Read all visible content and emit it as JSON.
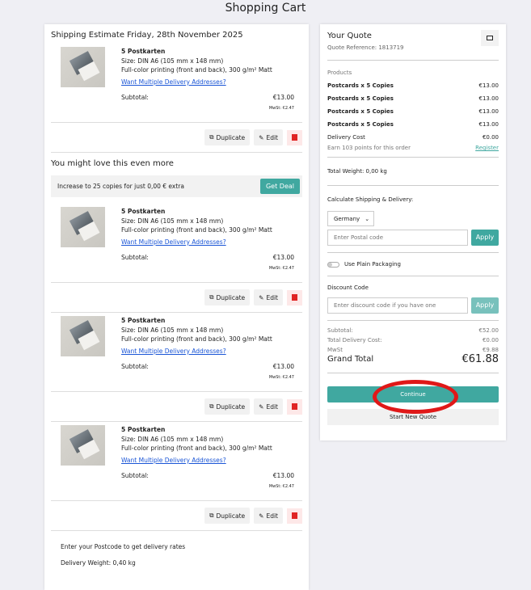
{
  "page_title": "Shopping Cart",
  "left": {
    "shipping_estimate": "Shipping Estimate Friday, 28th November 2025",
    "items": [
      {
        "name": "5 Postkarten",
        "size": "Size: DIN A6 (105 mm x 148 mm)",
        "finish": "Full-color printing (front and back), 300 g/m² Matt",
        "link": "Want Multiple Delivery Addresses?",
        "subtotal_label": "Subtotal:",
        "subtotal": "€13.00",
        "mwst": "MwSt: €2.47"
      },
      {
        "name": "5 Postkarten",
        "size": "Size: DIN A6 (105 mm x 148 mm)",
        "finish": "Full-color printing (front and back), 300 g/m² Matt",
        "link": "Want Multiple Delivery Addresses?",
        "subtotal_label": "Subtotal:",
        "subtotal": "€13.00",
        "mwst": "MwSt: €2.47"
      },
      {
        "name": "5 Postkarten",
        "size": "Size: DIN A6 (105 mm x 148 mm)",
        "finish": "Full-color printing (front and back), 300 g/m² Matt",
        "link": "Want Multiple Delivery Addresses?",
        "subtotal_label": "Subtotal:",
        "subtotal": "€13.00",
        "mwst": "MwSt: €2.47"
      },
      {
        "name": "5 Postkarten",
        "size": "Size: DIN A6 (105 mm x 148 mm)",
        "finish": "Full-color printing (front and back), 300 g/m² Matt",
        "link": "Want Multiple Delivery Addresses?",
        "subtotal_label": "Subtotal:",
        "subtotal": "€13.00",
        "mwst": "MwSt: €2.47"
      }
    ],
    "duplicate_label": "Duplicate",
    "edit_label": "Edit",
    "upsell_title": "You might love this even more",
    "upsell_text": "Increase to 25 copies for just 0,00 € extra",
    "get_deal": "Get Deal",
    "postcode_note": "Enter your Postcode to get delivery rates",
    "delivery_weight": "Delivery Weight: 0,40 kg"
  },
  "quote": {
    "title": "Your Quote",
    "reference": "Quote Reference: 1813719",
    "products_label": "Products",
    "products": [
      {
        "name": "Postcards x 5 Copies",
        "price": "€13.00"
      },
      {
        "name": "Postcards x 5 Copies",
        "price": "€13.00"
      },
      {
        "name": "Postcards x 5 Copies",
        "price": "€13.00"
      },
      {
        "name": "Postcards x 5 Copies",
        "price": "€13.00"
      }
    ],
    "delivery_label": "Delivery Cost",
    "delivery_value": "€0.00",
    "points": "Earn 103 points for this order",
    "register": "Register",
    "total_weight": "Total Weight: 0,00 kg",
    "calc_label": "Calculate Shipping & Delivery:",
    "country": "Germany",
    "postal_placeholder": "Enter Postal code",
    "apply": "Apply",
    "plain_packaging": "Use Plain Packaging",
    "discount_label": "Discount Code",
    "discount_placeholder": "Enter discount code if you have one",
    "subtotal_label": "Subtotal:",
    "subtotal": "€52.00",
    "total_delivery_label": "Total Delivery Cost:",
    "total_delivery": "€0.00",
    "mwst_label": "MwSt",
    "mwst": "€9.88",
    "grand_label": "Grand Total",
    "grand": "€61.88",
    "continue": "Continue",
    "new_quote": "Start New Quote"
  },
  "colors": {
    "accent": "#40a8a0",
    "annotation": "#e01818"
  }
}
